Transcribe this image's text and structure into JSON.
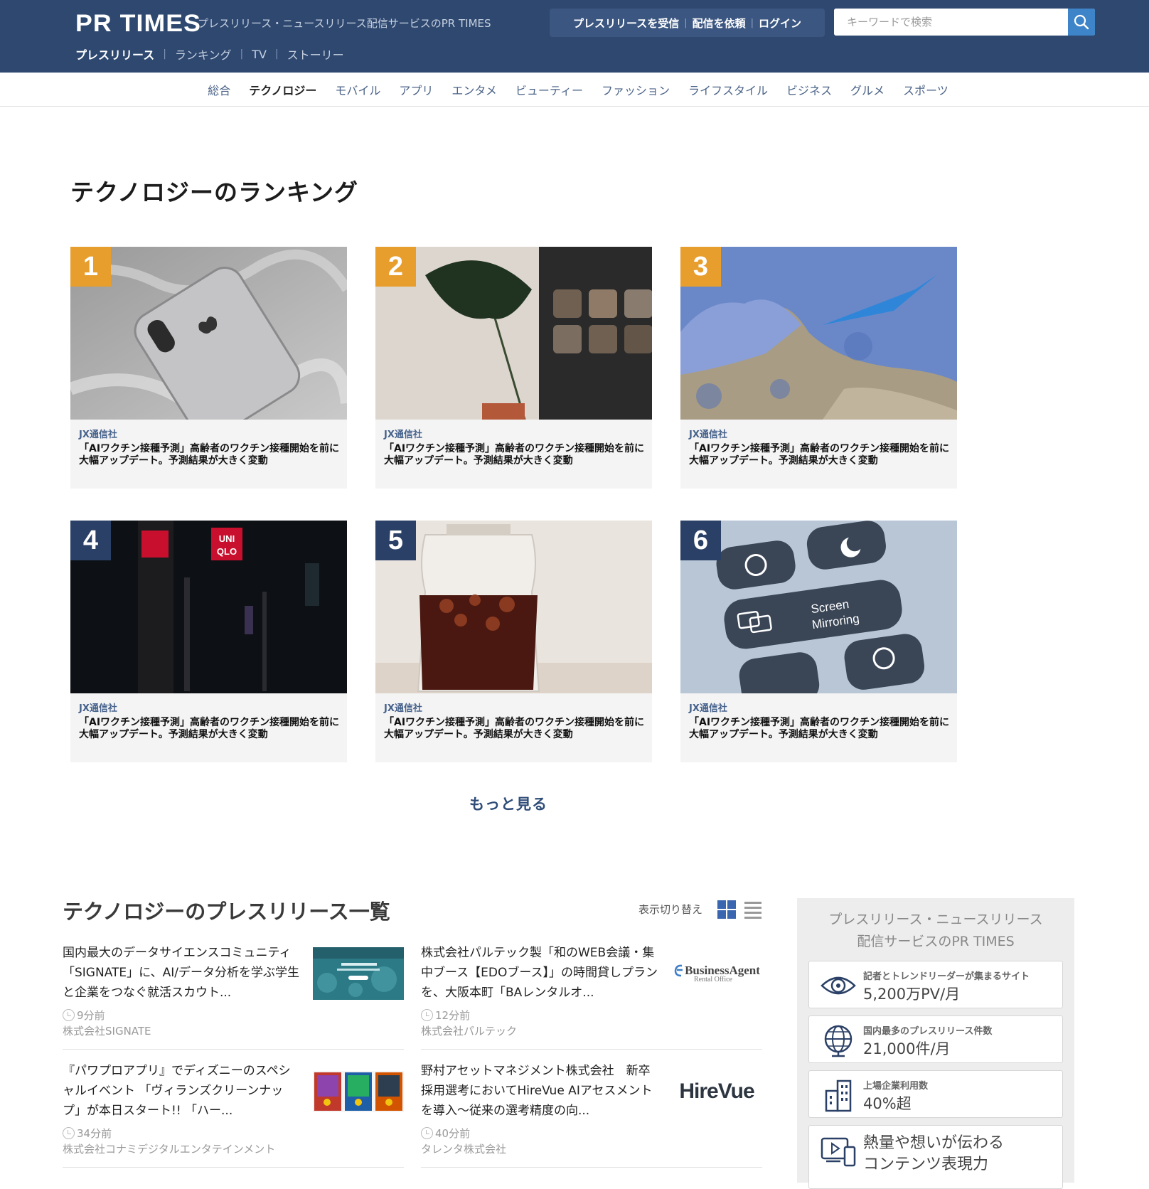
{
  "header": {
    "logo": "PR TIMES",
    "tagline": "プレスリリース・ニュースリリース配信サービスのPR TIMES",
    "subnav": [
      "プレスリリース",
      "ランキング",
      "TV",
      "ストーリー"
    ],
    "auth": [
      "プレスリリースを受信",
      "配信を依頼",
      "ログイン"
    ],
    "search_placeholder": "キーワードで検索"
  },
  "categories": [
    "総合",
    "テクノロジー",
    "モバイル",
    "アプリ",
    "エンタメ",
    "ビューティー",
    "ファッション",
    "ライフスタイル",
    "ビジネス",
    "グルメ",
    "スポーツ"
  ],
  "active_category": "テクノロジー",
  "ranking": {
    "title": "テクノロジーのランキング",
    "items": [
      {
        "rank": "1",
        "company": "JX通信社",
        "title": "「AIワクチン接種予測」高齢者のワクチン接種開始を前に大幅アップデート。予測結果が大きく変動"
      },
      {
        "rank": "2",
        "company": "JX通信社",
        "title": "「AIワクチン接種予測」高齢者のワクチン接種開始を前に大幅アップデート。予測結果が大きく変動"
      },
      {
        "rank": "3",
        "company": "JX通信社",
        "title": "「AIワクチン接種予測」高齢者のワクチン接種開始を前に大幅アップデート。予測結果が大きく変動"
      },
      {
        "rank": "4",
        "company": "JX通信社",
        "title": "「AIワクチン接種予測」高齢者のワクチン接種開始を前に大幅アップデート。予測結果が大きく変動"
      },
      {
        "rank": "5",
        "company": "JX通信社",
        "title": "「AIワクチン接種予測」高齢者のワクチン接種開始を前に大幅アップデート。予測結果が大きく変動"
      },
      {
        "rank": "6",
        "company": "JX通信社",
        "title": "「AIワクチン接種予測」高齢者のワクチン接種開始を前に大幅アップデート。予測結果が大きく変動"
      }
    ],
    "more": "もっと見る",
    "badge_colors": {
      "top3": "#e79e2c",
      "rest": "#2b4066"
    }
  },
  "releases": {
    "title": "テクノロジーのプレスリリース一覧",
    "toggle_label": "表示切り替え",
    "items": [
      {
        "title": "国内最大のデータサイエンスコミュニティ「SIGNATE」に、AI/データ分析を学ぶ学生と企業をつなぐ就活スカウト...",
        "time": "9分前",
        "company": "株式会社SIGNATE"
      },
      {
        "title": "株式会社パルテック製「和のWEB会議・集中ブース【EDOブース】」の時間貸しプランを、大阪本町「BAレンタルオ...",
        "time": "12分前",
        "company": "株式会社パルテック",
        "thumb_text": "BusinessAgent",
        "thumb_sub": "Rental Office"
      },
      {
        "title": "『パワプロアプリ』でディズニーのスペシャルイベント 「ヴィランズクリーンナップ」が本日スタート!! 「ハー...",
        "time": "34分前",
        "company": "株式会社コナミデジタルエンタテインメント"
      },
      {
        "title": "野村アセットマネジメント株式会社　新卒採用選考においてHireVue AIアセスメントを導入～従来の選考精度の向...",
        "time": "40分前",
        "company": "タレンタ株式会社",
        "thumb_text": "HireVue"
      }
    ]
  },
  "sidebar": {
    "head_line1": "プレスリリース・ニュースリリース",
    "head_line2": "配信サービスのPR TIMES",
    "stats": [
      {
        "label": "記者とトレンドリーダーが集まるサイト",
        "value": "5,200万PV/月",
        "icon": "eye-icon"
      },
      {
        "label": "国内最多のプレスリリース件数",
        "value": "21,000件/月",
        "icon": "globe-icon"
      },
      {
        "label": "上場企業利用数",
        "value": "40%超",
        "icon": "building-icon"
      },
      {
        "line1": "熱量や想いが伝わる",
        "line2": "コンテンツ表現力",
        "icon": "media-icon"
      }
    ]
  }
}
